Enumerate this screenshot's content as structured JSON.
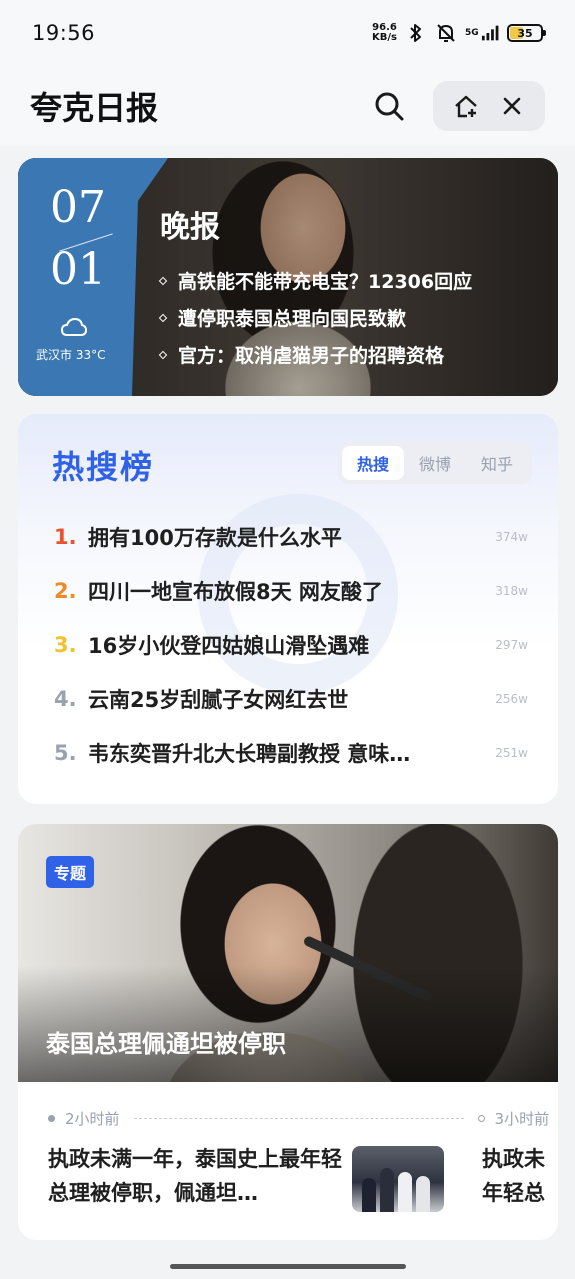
{
  "status_bar": {
    "time": "19:56",
    "net_speed_value": "96.6",
    "net_speed_unit": "KB/s",
    "network": "5G",
    "battery": "35"
  },
  "header": {
    "title": "夸克日报",
    "icons": [
      "search-icon",
      "add-to-home-icon",
      "close-icon"
    ]
  },
  "evening": {
    "month": "07",
    "day": "01",
    "weather": "武汉市 33°C",
    "title": "晚报",
    "items": [
      "高铁能不能带充电宝？12306回应",
      "遭停职泰国总理向国民致歉",
      "官方：取消虐猫男子的招聘资格"
    ]
  },
  "hot_search": {
    "title": "热搜榜",
    "tabs": [
      "热搜",
      "微博",
      "知乎"
    ],
    "active_tab": "热搜",
    "rank_colors": [
      "#e8532f",
      "#f08a24",
      "#f2c12e",
      "#9aa1af",
      "#9aa1af"
    ],
    "items": [
      {
        "rank": "1.",
        "text": "拥有100万存款是什么水平",
        "count": "374w"
      },
      {
        "rank": "2.",
        "text": "四川一地宣布放假8天 网友酸了",
        "count": "318w"
      },
      {
        "rank": "3.",
        "text": "16岁小伙登四姑娘山滑坠遇难",
        "count": "297w"
      },
      {
        "rank": "4.",
        "text": "云南25岁刮腻子女网红去世",
        "count": "256w"
      },
      {
        "rank": "5.",
        "text": "韦东奕晋升北大长聘副教授 意味…",
        "count": "251w"
      }
    ]
  },
  "topic": {
    "badge": "专题",
    "title": "泰国总理佩通坦被停职",
    "timeline": [
      {
        "time": "2小时前",
        "headline": "执政未满一年，泰国史上最年轻总理被停职，佩通坦…"
      },
      {
        "time": "3小时前",
        "headline": "执政未\n年轻总"
      }
    ]
  }
}
